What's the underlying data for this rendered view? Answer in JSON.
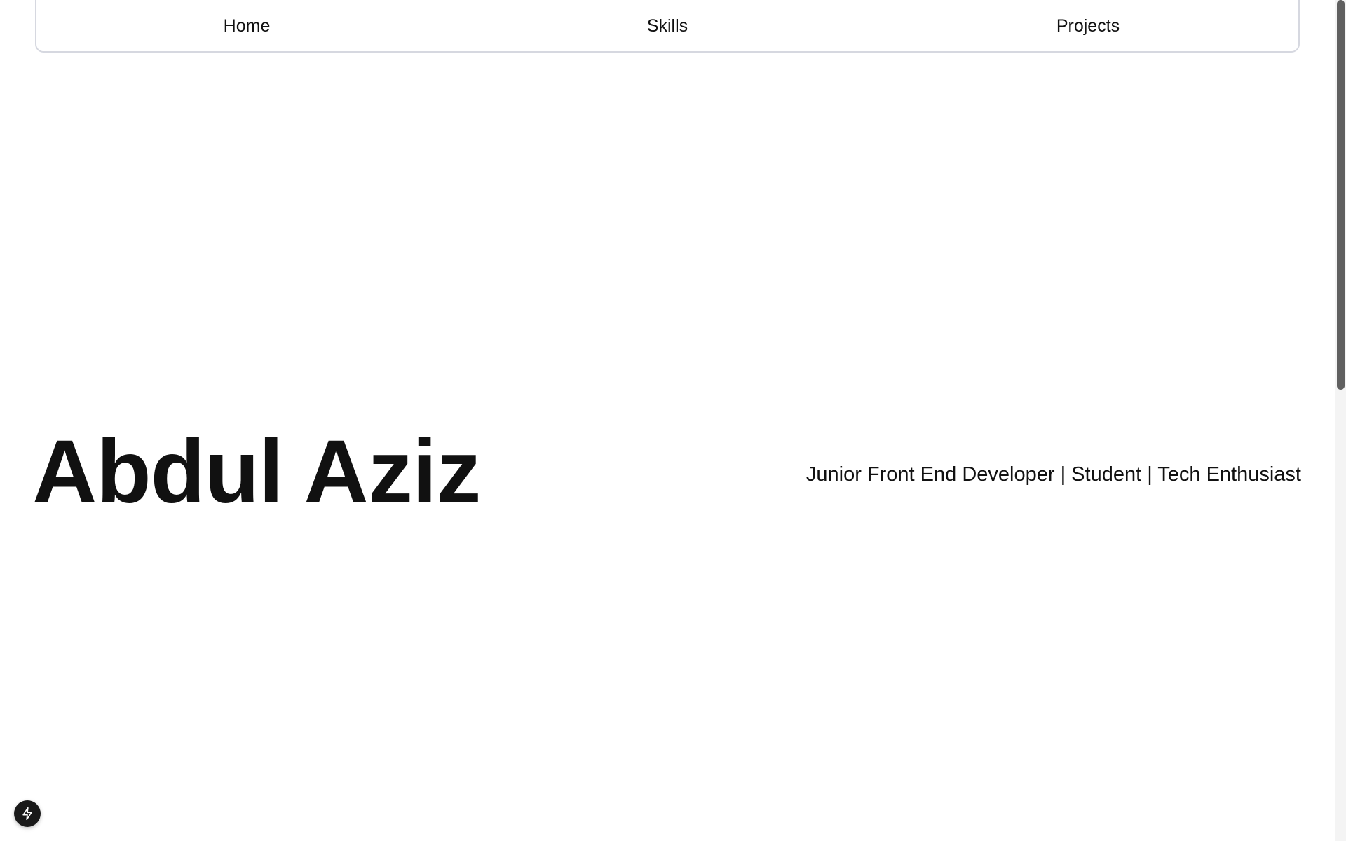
{
  "nav": {
    "items": [
      {
        "label": "Home"
      },
      {
        "label": "Skills"
      },
      {
        "label": "Projects"
      }
    ]
  },
  "hero": {
    "name": "Abdul Aziz",
    "tagline": "Junior Front End Developer | Student | Tech Enthusiast"
  },
  "dev_indicator": {
    "icon": "lightning-bolt-icon"
  },
  "colors": {
    "text": "#111111",
    "background": "#ffffff",
    "nav_border": "#d6d8e0",
    "indicator_bg": "#1a1a1a"
  }
}
